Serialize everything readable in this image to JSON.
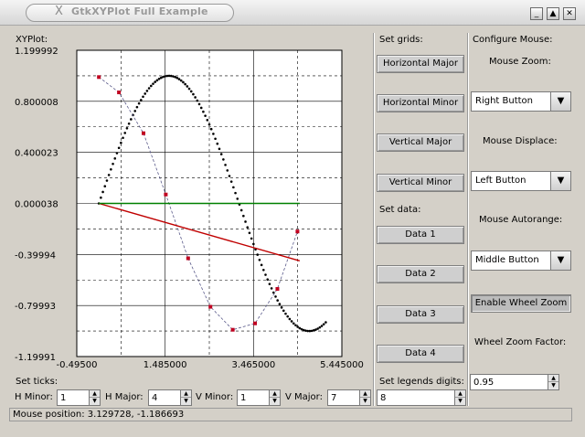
{
  "window": {
    "title": "GtkXYPlot Full Example",
    "close_glyph": "X",
    "buttons": [
      "_",
      "▲",
      "✕"
    ]
  },
  "plot_group": {
    "title": "XYPlot:"
  },
  "chart_data": {
    "type": "line",
    "ylim": [
      -1.19991,
      1.199992
    ],
    "xlim": [
      -0.495,
      5.445
    ],
    "y_tick_labels": [
      "1.199992",
      "0.800008",
      "0.400023",
      "0.000038",
      "-0.39994",
      "-0.79993",
      "-1.19991"
    ],
    "x_tick_labels": [
      "-0.49500",
      "1.485000",
      "3.465000",
      "5.445000"
    ],
    "grid": true,
    "series": [
      {
        "style": "dotted",
        "color": "#000000",
        "function": "sin",
        "x": [
          0.0,
          0.15,
          0.3,
          0.45,
          0.6,
          0.75,
          0.9,
          1.05,
          1.2,
          1.35,
          1.5,
          1.65,
          1.8,
          1.95,
          2.1,
          2.25,
          2.4,
          2.55,
          2.7,
          2.85,
          3.0,
          3.15,
          3.3,
          3.45,
          3.6,
          3.75,
          3.9,
          4.05,
          4.2,
          4.35,
          4.5,
          4.65,
          4.8,
          4.95,
          5.1
        ],
        "y": [
          0.0,
          0.149,
          0.296,
          0.435,
          0.565,
          0.682,
          0.783,
          0.867,
          0.932,
          0.976,
          0.997,
          0.997,
          0.974,
          0.929,
          0.863,
          0.778,
          0.675,
          0.557,
          0.427,
          0.287,
          0.141,
          -0.008,
          -0.158,
          -0.304,
          -0.443,
          -0.572,
          -0.688,
          -0.788,
          -0.872,
          -0.935,
          -0.978,
          -0.998,
          -0.996,
          -0.971,
          -0.926
        ]
      },
      {
        "style": "dashed-markers",
        "color": "#c00020",
        "x": [
          0.0,
          0.45,
          1.0,
          1.5,
          2.0,
          2.5,
          3.0,
          3.5,
          4.0,
          4.45
        ],
        "y": [
          0.99,
          0.87,
          0.55,
          0.07,
          -0.43,
          -0.81,
          -0.99,
          -0.94,
          -0.67,
          -0.22
        ]
      },
      {
        "style": "solid",
        "color": "#c00000",
        "x": [
          0.0,
          4.5
        ],
        "y": [
          0.0,
          -0.45
        ]
      },
      {
        "style": "solid",
        "color": "#008000",
        "x": [
          0.0,
          4.5
        ],
        "y": [
          0.0,
          0.0
        ]
      }
    ]
  },
  "set_grids": {
    "title": "Set grids:",
    "buttons": [
      "Horizontal Major",
      "Horizontal Minor",
      "Vertical Major",
      "Vertical Minor"
    ]
  },
  "set_data": {
    "title": "Set data:",
    "buttons": [
      "Data 1",
      "Data 2",
      "Data 3",
      "Data 4"
    ]
  },
  "configure_mouse": {
    "title": "Configure Mouse:",
    "zoom_label": "Mouse Zoom:",
    "zoom_value": "Right Button",
    "displace_label": "Mouse Displace:",
    "displace_value": "Left Button",
    "autorange_label": "Mouse Autorange:",
    "autorange_value": "Middle Button",
    "wheel_zoom_button": "Enable Wheel Zoom",
    "wheel_factor_label": "Wheel Zoom Factor:",
    "wheel_factor_value": "0.95"
  },
  "set_ticks": {
    "title": "Set ticks:",
    "h_minor_label": "H Minor:",
    "h_minor_value": "1",
    "h_major_label": "H Major:",
    "h_major_value": "4",
    "v_minor_label": "V Minor:",
    "v_minor_value": "1",
    "v_major_label": "V Major:",
    "v_major_value": "7"
  },
  "legend_digits": {
    "title": "Set legends digits:",
    "value": "8"
  },
  "status": {
    "text": "Mouse position: 3.129728, -1.186693"
  }
}
